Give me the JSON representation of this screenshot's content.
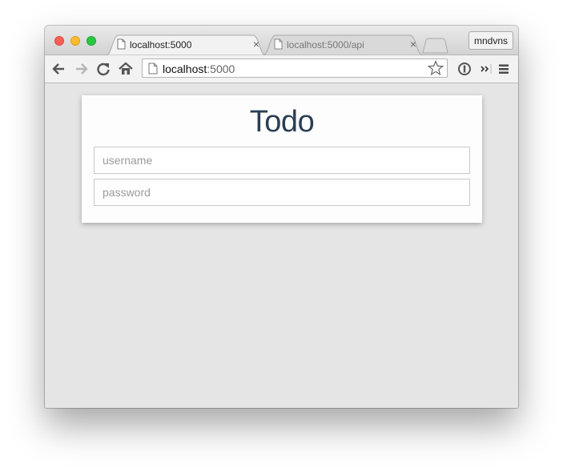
{
  "tabs": [
    {
      "title": "localhost:5000",
      "active": true
    },
    {
      "title": "localhost:5000/api",
      "active": false
    }
  ],
  "user_button": "mndvns",
  "toolbar": {
    "url_host": "localhost",
    "url_port": ":5000",
    "icons": [
      "back-arrow-icon",
      "forward-arrow-icon",
      "reload-icon",
      "home-icon",
      "star-icon",
      "extension-icon",
      "overflow-chevron-icon",
      "menu-icon"
    ]
  },
  "page": {
    "heading": "Todo",
    "username_placeholder": "username",
    "password_placeholder": "password"
  },
  "colors": {
    "heading": "#2a3f55",
    "background": "#e5e5e5",
    "card": "#fdfdfd"
  }
}
